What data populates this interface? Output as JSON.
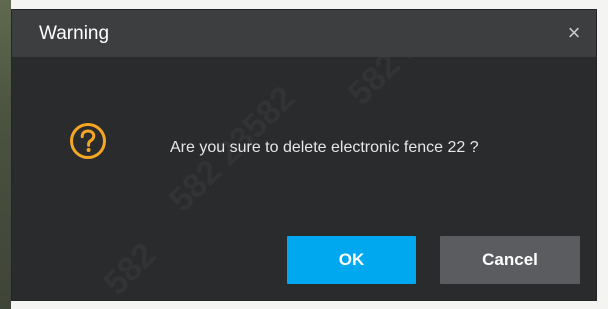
{
  "dialog": {
    "title": "Warning",
    "close_glyph": "×",
    "icon": "question-icon",
    "message": "Are you sure to delete electronic fence 22 ?",
    "ok_label": "OK",
    "cancel_label": "Cancel"
  },
  "colors": {
    "dialog_bg": "#2a2b2d",
    "header_bg": "#3d3e40",
    "accent": "#00a8f0",
    "warning_icon": "#f5a623",
    "cancel_bg": "#5a5c60"
  }
}
